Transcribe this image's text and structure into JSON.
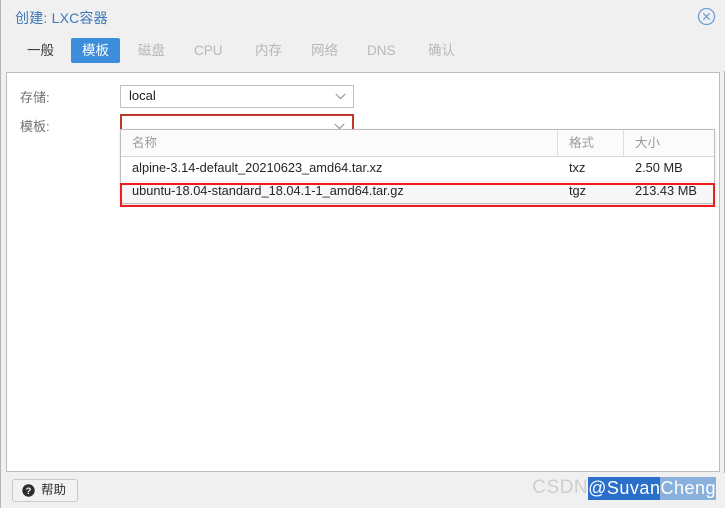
{
  "window": {
    "title": "创建: LXC容器",
    "close_icon": "close-circle-icon",
    "accent_color": "#3c8ddc",
    "title_color": "#3c77bb"
  },
  "tabs": [
    {
      "label": "一般",
      "state": "enabled"
    },
    {
      "label": "模板",
      "state": "active"
    },
    {
      "label": "磁盘",
      "state": "disabled"
    },
    {
      "label": "CPU",
      "state": "disabled"
    },
    {
      "label": "内存",
      "state": "disabled"
    },
    {
      "label": "网络",
      "state": "disabled"
    },
    {
      "label": "DNS",
      "state": "disabled"
    },
    {
      "label": "确认",
      "state": "disabled"
    }
  ],
  "form": {
    "storage": {
      "label": "存储:",
      "value": "local",
      "arrow_icon": "chevron-down-icon"
    },
    "template": {
      "label": "模板:",
      "value": "",
      "placeholder": "",
      "arrow_icon": "chevron-down-icon",
      "highlight_color": "#c0392b"
    }
  },
  "dropdown": {
    "columns": [
      "名称",
      "格式",
      "大小"
    ],
    "rows": [
      {
        "name": "alpine-3.14-default_20210623_amd64.tar.xz",
        "format": "txz",
        "size": "2.50 MB",
        "selected": false
      },
      {
        "name": "ubuntu-18.04-standard_18.04.1-1_amd64.tar.gz",
        "format": "tgz",
        "size": "213.43 MB",
        "selected": true
      }
    ],
    "highlight_color": "#ee1c1c"
  },
  "footer": {
    "help_label": "帮助",
    "help_icon": "question-circle-icon"
  },
  "watermark": {
    "faint_text": "CSDN",
    "selected_text_a": "@Suvan",
    "selected_text_b": "Cheng"
  }
}
